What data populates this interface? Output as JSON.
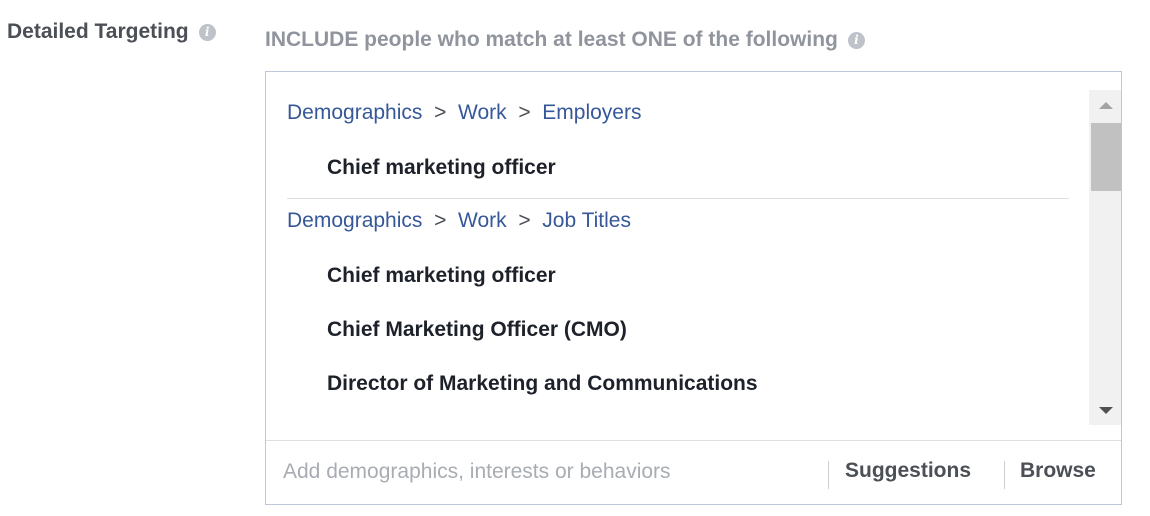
{
  "targeting": {
    "label": "Detailed Targeting",
    "include_header": "INCLUDE people who match at least ONE of the following",
    "info_icon_glyph": "i",
    "groups": [
      {
        "breadcrumb": [
          "Demographics",
          "Work",
          "Employers"
        ],
        "items": [
          "Chief marketing officer"
        ]
      },
      {
        "breadcrumb": [
          "Demographics",
          "Work",
          "Job Titles"
        ],
        "items": [
          "Chief marketing officer",
          "Chief Marketing Officer (CMO)",
          "Director of Marketing and Communications"
        ]
      }
    ],
    "breadcrumb_separator": ">",
    "search": {
      "placeholder": "Add demographics, interests or behaviors",
      "value": ""
    },
    "suggestions_label": "Suggestions",
    "browse_label": "Browse"
  },
  "colors": {
    "link": "#365899",
    "label": "#4b4f56",
    "muted": "#90949c",
    "border": "#bdc7d8"
  }
}
